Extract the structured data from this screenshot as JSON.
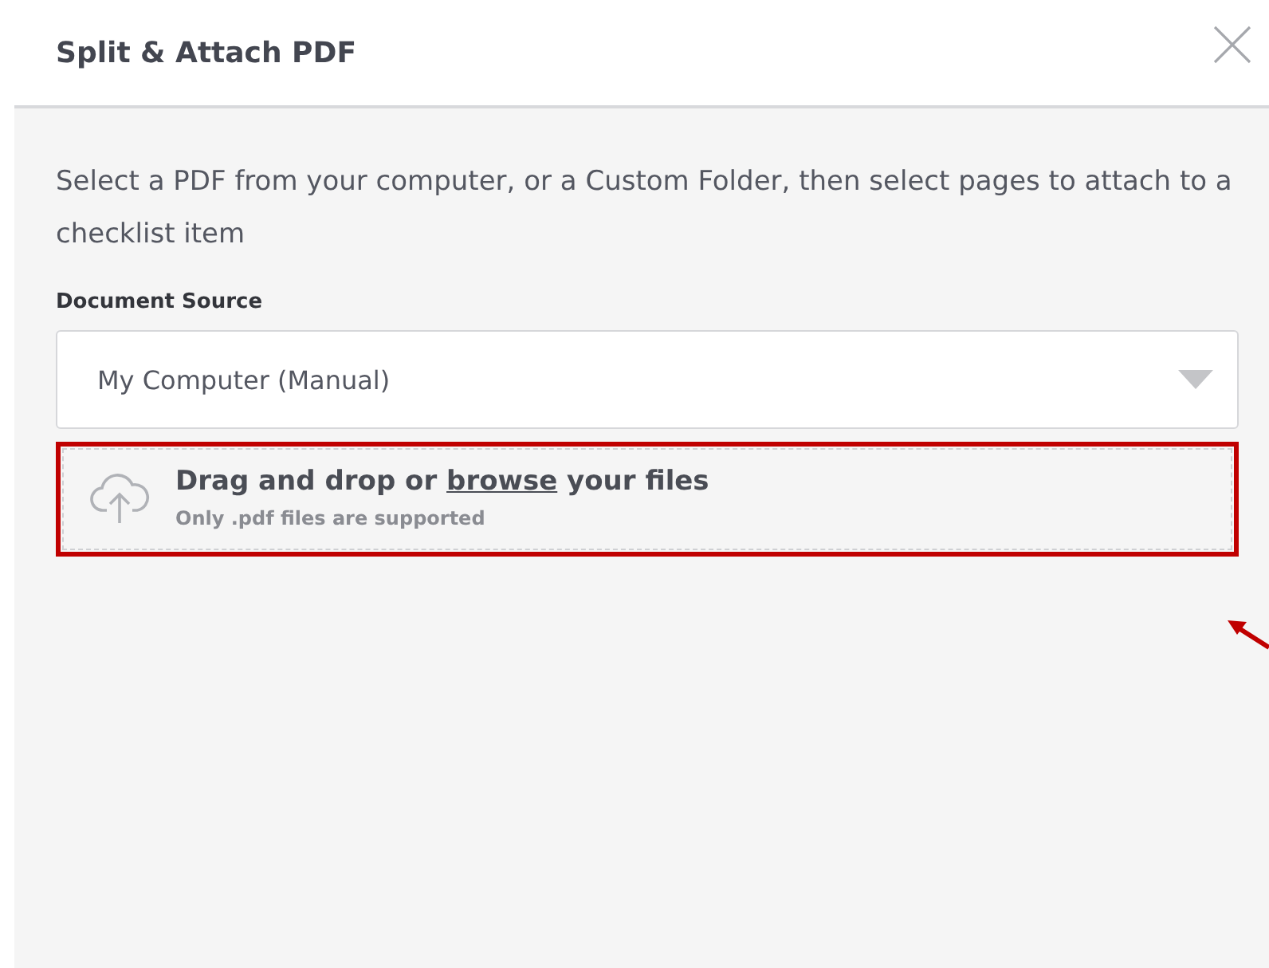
{
  "dialog": {
    "title": "Split & Attach PDF"
  },
  "description": "Select a PDF from your computer, or a Custom Folder, then select pages to attach to a checklist item",
  "source": {
    "label": "Document Source",
    "value": "My Computer (Manual)"
  },
  "dropzone": {
    "prefix": "Drag and drop or",
    "link": "browse",
    "suffix": "your files",
    "hint": "Only .pdf files are supported"
  }
}
